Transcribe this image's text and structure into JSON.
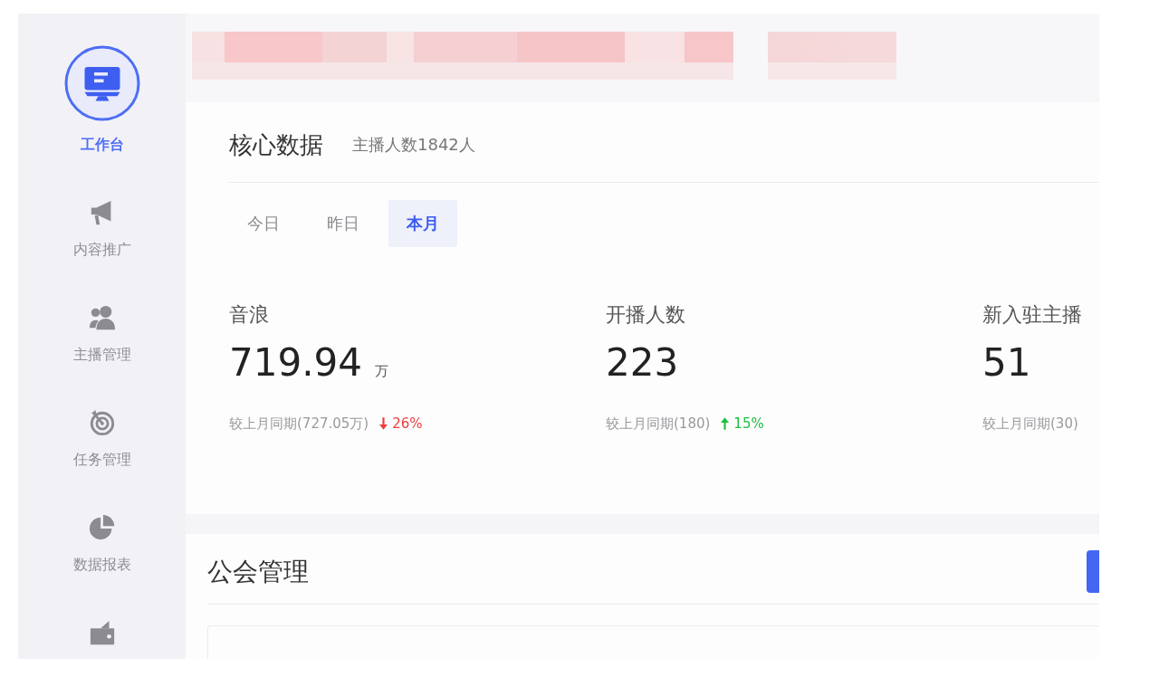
{
  "sidebar": {
    "items": [
      {
        "label": "工作台",
        "selected": true
      },
      {
        "label": "内容推广",
        "selected": false
      },
      {
        "label": "主播管理",
        "selected": false
      },
      {
        "label": "任务管理",
        "selected": false
      },
      {
        "label": "数据报表",
        "selected": false
      },
      {
        "selected": false
      }
    ]
  },
  "core_data": {
    "title": "核心数据",
    "subtitle": "主播人数1842人",
    "tabs": [
      {
        "label": "今日",
        "selected": false
      },
      {
        "label": "昨日",
        "selected": false
      },
      {
        "label": "本月",
        "selected": true
      }
    ],
    "metrics": [
      {
        "label": "音浪",
        "value": "719.94",
        "unit": "万",
        "comparison": "较上月同期(727.05万)",
        "change": {
          "up": false,
          "text": "26%"
        }
      },
      {
        "label": "开播人数",
        "value": "223",
        "comparison": "较上月同期(180)",
        "change": {
          "up": true,
          "text": "15%"
        }
      },
      {
        "label": "新入驻主播",
        "value": "51",
        "comparison": "较上月同期(30)"
      }
    ]
  },
  "guild": {
    "title": "公会管理"
  }
}
